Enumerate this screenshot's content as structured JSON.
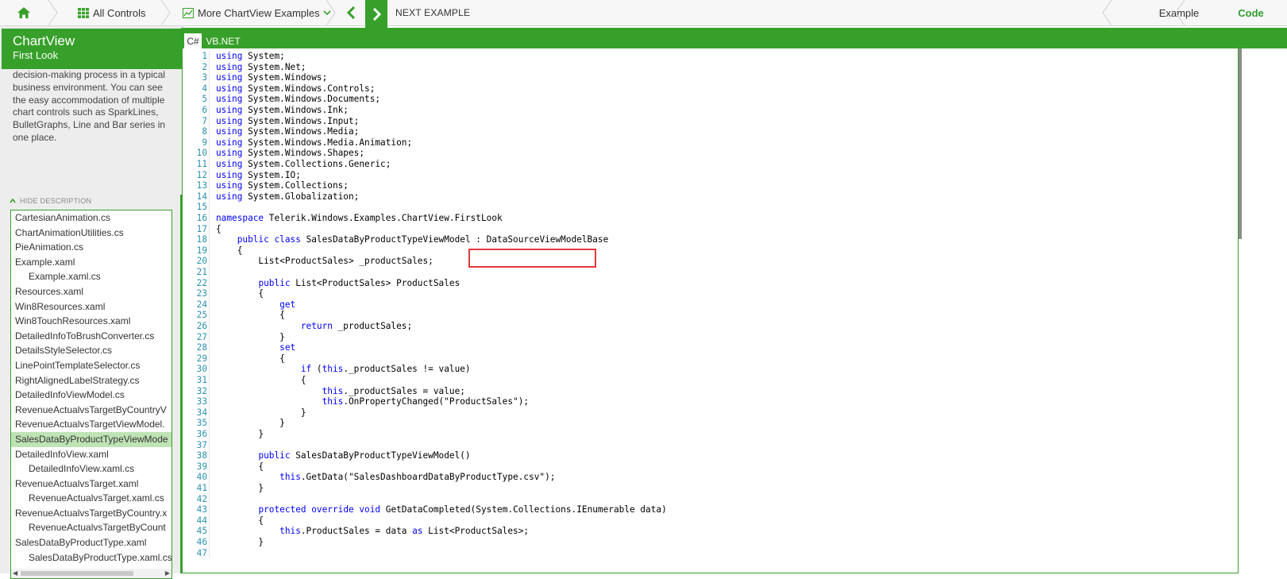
{
  "topbar": {
    "all_controls": "All Controls",
    "more_examples": "More ChartView Examples",
    "next_example": "NEXT EXAMPLE",
    "tab_example": "Example",
    "tab_code": "Code",
    "accent": "#37a02a"
  },
  "sidebar": {
    "title": "ChartView",
    "subtitle": "First Look",
    "description": "decision-making process in a typical business environment. You can see the easy accommodation of multiple chart controls such as SparkLines, BulletGraphs, Line and Bar series in one place.",
    "hide_description": "HIDE DESCRIPTION",
    "files": [
      {
        "name": "CartesianAnimation.cs",
        "indent": false,
        "selected": false
      },
      {
        "name": "ChartAnimationUtilities.cs",
        "indent": false,
        "selected": false
      },
      {
        "name": "PieAnimation.cs",
        "indent": false,
        "selected": false
      },
      {
        "name": "Example.xaml",
        "indent": false,
        "selected": false
      },
      {
        "name": "Example.xaml.cs",
        "indent": true,
        "selected": false
      },
      {
        "name": "Resources.xaml",
        "indent": false,
        "selected": false
      },
      {
        "name": "Win8Resources.xaml",
        "indent": false,
        "selected": false
      },
      {
        "name": "Win8TouchResources.xaml",
        "indent": false,
        "selected": false
      },
      {
        "name": "DetailedInfoToBrushConverter.cs",
        "indent": false,
        "selected": false
      },
      {
        "name": "DetailsStyleSelector.cs",
        "indent": false,
        "selected": false
      },
      {
        "name": "LinePointTemplateSelector.cs",
        "indent": false,
        "selected": false
      },
      {
        "name": "RightAlignedLabelStrategy.cs",
        "indent": false,
        "selected": false
      },
      {
        "name": "DetailedInfoViewModel.cs",
        "indent": false,
        "selected": false
      },
      {
        "name": "RevenueActualvsTargetByCountryV",
        "indent": false,
        "selected": false
      },
      {
        "name": "RevenueActualvsTargetViewModel.",
        "indent": false,
        "selected": false
      },
      {
        "name": "SalesDataByProductTypeViewMode",
        "indent": false,
        "selected": true
      },
      {
        "name": "DetailedInfoView.xaml",
        "indent": false,
        "selected": false
      },
      {
        "name": "DetailedInfoView.xaml.cs",
        "indent": true,
        "selected": false
      },
      {
        "name": "RevenueActualvsTarget.xaml",
        "indent": false,
        "selected": false
      },
      {
        "name": "RevenueActualvsTarget.xaml.cs",
        "indent": true,
        "selected": false
      },
      {
        "name": "RevenueActualvsTargetByCountry.x",
        "indent": false,
        "selected": false
      },
      {
        "name": "RevenueActualvsTargetByCount",
        "indent": true,
        "selected": false
      },
      {
        "name": "SalesDataByProductType.xaml",
        "indent": false,
        "selected": false
      },
      {
        "name": "SalesDataByProductType.xaml.cs",
        "indent": true,
        "selected": false
      }
    ]
  },
  "code": {
    "tab_cs": "C#",
    "tab_vb": "VB.NET",
    "lines": [
      [
        {
          "k": "using"
        },
        {
          "t": " System;"
        }
      ],
      [
        {
          "k": "using"
        },
        {
          "t": " System.Net;"
        }
      ],
      [
        {
          "k": "using"
        },
        {
          "t": " System.Windows;"
        }
      ],
      [
        {
          "k": "using"
        },
        {
          "t": " System.Windows.Controls;"
        }
      ],
      [
        {
          "k": "using"
        },
        {
          "t": " System.Windows.Documents;"
        }
      ],
      [
        {
          "k": "using"
        },
        {
          "t": " System.Windows.Ink;"
        }
      ],
      [
        {
          "k": "using"
        },
        {
          "t": " System.Windows.Input;"
        }
      ],
      [
        {
          "k": "using"
        },
        {
          "t": " System.Windows.Media;"
        }
      ],
      [
        {
          "k": "using"
        },
        {
          "t": " System.Windows.Media.Animation;"
        }
      ],
      [
        {
          "k": "using"
        },
        {
          "t": " System.Windows.Shapes;"
        }
      ],
      [
        {
          "k": "using"
        },
        {
          "t": " System.Collections.Generic;"
        }
      ],
      [
        {
          "k": "using"
        },
        {
          "t": " System.IO;"
        }
      ],
      [
        {
          "k": "using"
        },
        {
          "t": " System.Collections;"
        }
      ],
      [
        {
          "k": "using"
        },
        {
          "t": " System.Globalization;"
        }
      ],
      [],
      [
        {
          "k": "namespace"
        },
        {
          "t": " Telerik.Windows.Examples.ChartView.FirstLook"
        }
      ],
      [
        {
          "t": "{"
        }
      ],
      [
        {
          "t": "    "
        },
        {
          "k": "public"
        },
        {
          "t": " "
        },
        {
          "k": "class"
        },
        {
          "t": " SalesDataByProductTypeViewModel : DataSourceViewModelBase"
        }
      ],
      [
        {
          "t": "    {"
        }
      ],
      [
        {
          "t": "        List<ProductSales> _productSales;"
        }
      ],
      [],
      [
        {
          "t": "        "
        },
        {
          "k": "public"
        },
        {
          "t": " List<ProductSales> ProductSales"
        }
      ],
      [
        {
          "t": "        {"
        }
      ],
      [
        {
          "t": "            "
        },
        {
          "k": "get"
        }
      ],
      [
        {
          "t": "            {"
        }
      ],
      [
        {
          "t": "                "
        },
        {
          "k": "return"
        },
        {
          "t": " _productSales;"
        }
      ],
      [
        {
          "t": "            }"
        }
      ],
      [
        {
          "t": "            "
        },
        {
          "k": "set"
        }
      ],
      [
        {
          "t": "            {"
        }
      ],
      [
        {
          "t": "                "
        },
        {
          "k": "if"
        },
        {
          "t": " ("
        },
        {
          "k": "this"
        },
        {
          "t": "._productSales != value)"
        }
      ],
      [
        {
          "t": "                {"
        }
      ],
      [
        {
          "t": "                    "
        },
        {
          "k": "this"
        },
        {
          "t": "._productSales = value;"
        }
      ],
      [
        {
          "t": "                    "
        },
        {
          "k": "this"
        },
        {
          "t": ".OnPropertyChanged(\"ProductSales\");"
        }
      ],
      [
        {
          "t": "                }"
        }
      ],
      [
        {
          "t": "            }"
        }
      ],
      [
        {
          "t": "        }"
        }
      ],
      [],
      [
        {
          "t": "        "
        },
        {
          "k": "public"
        },
        {
          "t": " SalesDataByProductTypeViewModel()"
        }
      ],
      [
        {
          "t": "        {"
        }
      ],
      [
        {
          "t": "            "
        },
        {
          "k": "this"
        },
        {
          "t": ".GetData(\"SalesDashboardDataByProductType.csv\");"
        }
      ],
      [
        {
          "t": "        }"
        }
      ],
      [],
      [
        {
          "t": "        "
        },
        {
          "k": "protected"
        },
        {
          "t": " "
        },
        {
          "k": "override"
        },
        {
          "t": " "
        },
        {
          "k": "void"
        },
        {
          "t": " GetDataCompleted(System.Collections.IEnumerable data)"
        }
      ],
      [
        {
          "t": "        {"
        }
      ],
      [
        {
          "t": "            "
        },
        {
          "k": "this"
        },
        {
          "t": ".ProductSales = data "
        },
        {
          "k": "as"
        },
        {
          "t": " List<ProductSales>;"
        }
      ],
      [
        {
          "t": "        }"
        }
      ],
      []
    ]
  }
}
